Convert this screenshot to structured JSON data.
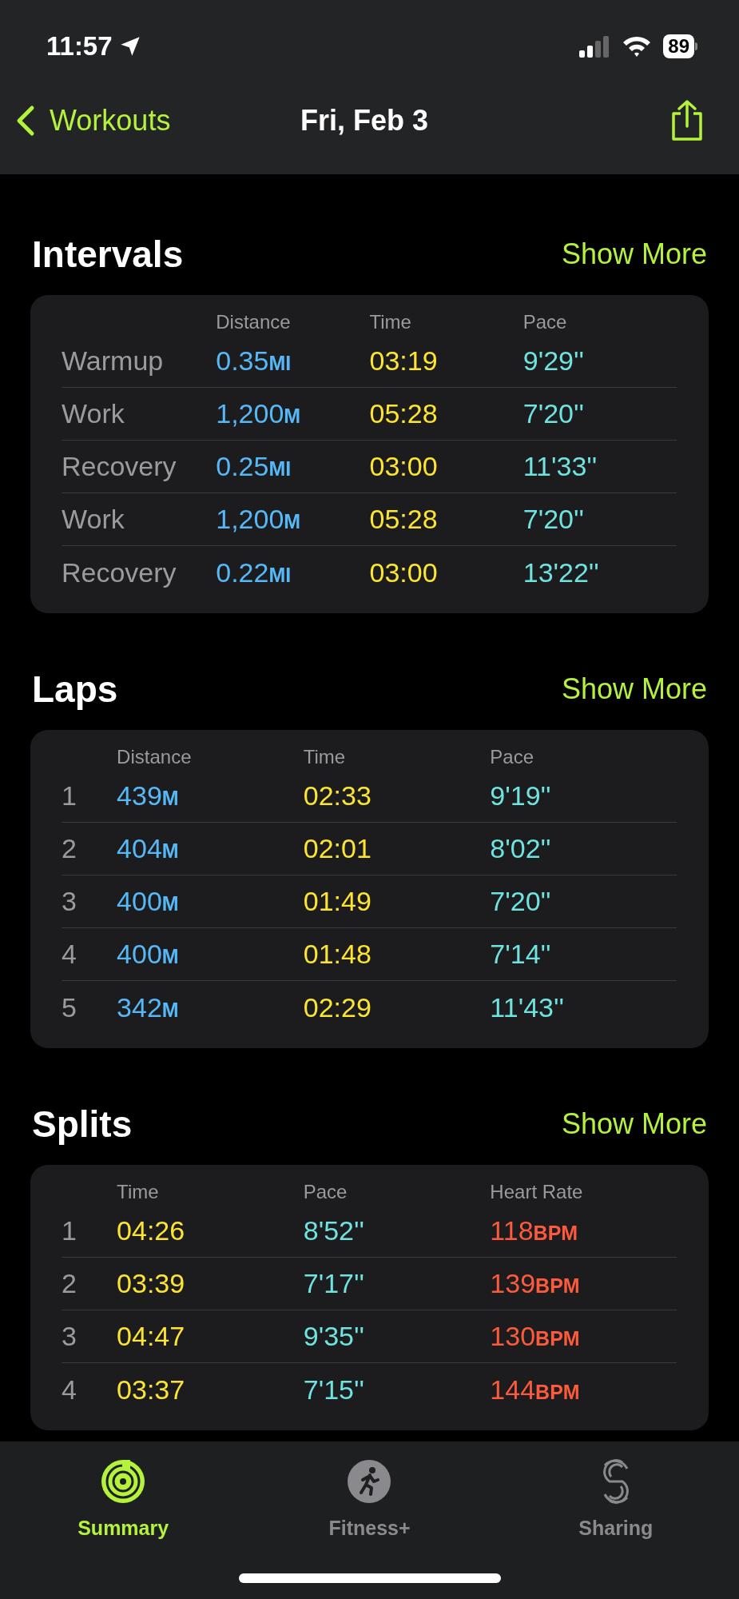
{
  "status_bar": {
    "time": "11:57",
    "battery": "89"
  },
  "nav": {
    "back": "Workouts",
    "title": "Fri, Feb 3"
  },
  "sections": [
    {
      "title": "Intervals",
      "action": "Show More",
      "columns": [
        {
          "kind": "label"
        },
        {
          "kind": "distance",
          "label": "Distance"
        },
        {
          "kind": "time",
          "label": "Time"
        },
        {
          "kind": "pace",
          "label": "Pace"
        }
      ],
      "rows": [
        [
          {
            "value": "Warmup"
          },
          {
            "value": "0.35",
            "unit": "MI"
          },
          {
            "value": "03:19"
          },
          {
            "value": "9'29''"
          }
        ],
        [
          {
            "value": "Work"
          },
          {
            "value": "1,200",
            "unit": "M"
          },
          {
            "value": "05:28"
          },
          {
            "value": "7'20''"
          }
        ],
        [
          {
            "value": "Recovery"
          },
          {
            "value": "0.25",
            "unit": "MI"
          },
          {
            "value": "03:00"
          },
          {
            "value": "11'33''"
          }
        ],
        [
          {
            "value": "Work"
          },
          {
            "value": "1,200",
            "unit": "M"
          },
          {
            "value": "05:28"
          },
          {
            "value": "7'20''"
          }
        ],
        [
          {
            "value": "Recovery"
          },
          {
            "value": "0.22",
            "unit": "MI"
          },
          {
            "value": "03:00"
          },
          {
            "value": "13'22''"
          }
        ]
      ]
    },
    {
      "title": "Laps",
      "action": "Show More",
      "columns": [
        {
          "kind": "index"
        },
        {
          "kind": "distance",
          "label": "Distance"
        },
        {
          "kind": "time",
          "label": "Time"
        },
        {
          "kind": "pace",
          "label": "Pace"
        }
      ],
      "rows": [
        [
          {
            "value": "1"
          },
          {
            "value": "439",
            "unit": "M"
          },
          {
            "value": "02:33"
          },
          {
            "value": "9'19''"
          }
        ],
        [
          {
            "value": "2"
          },
          {
            "value": "404",
            "unit": "M"
          },
          {
            "value": "02:01"
          },
          {
            "value": "8'02''"
          }
        ],
        [
          {
            "value": "3"
          },
          {
            "value": "400",
            "unit": "M"
          },
          {
            "value": "01:49"
          },
          {
            "value": "7'20''"
          }
        ],
        [
          {
            "value": "4"
          },
          {
            "value": "400",
            "unit": "M"
          },
          {
            "value": "01:48"
          },
          {
            "value": "7'14''"
          }
        ],
        [
          {
            "value": "5"
          },
          {
            "value": "342",
            "unit": "M"
          },
          {
            "value": "02:29"
          },
          {
            "value": "11'43''"
          }
        ]
      ]
    },
    {
      "title": "Splits",
      "action": "Show More",
      "columns": [
        {
          "kind": "index"
        },
        {
          "kind": "time",
          "label": "Time"
        },
        {
          "kind": "pace",
          "label": "Pace"
        },
        {
          "kind": "heart_rate",
          "label": "Heart Rate"
        }
      ],
      "rows": [
        [
          {
            "value": "1"
          },
          {
            "value": "04:26"
          },
          {
            "value": "8'52''"
          },
          {
            "value": "118",
            "unit": "BPM"
          }
        ],
        [
          {
            "value": "2"
          },
          {
            "value": "03:39"
          },
          {
            "value": "7'17''"
          },
          {
            "value": "139",
            "unit": "BPM"
          }
        ],
        [
          {
            "value": "3"
          },
          {
            "value": "04:47"
          },
          {
            "value": "9'35''"
          },
          {
            "value": "130",
            "unit": "BPM"
          }
        ],
        [
          {
            "value": "4"
          },
          {
            "value": "03:37"
          },
          {
            "value": "7'15''"
          },
          {
            "value": "144",
            "unit": "BPM"
          }
        ]
      ]
    }
  ],
  "tabs": [
    {
      "label": "Summary",
      "kind": "rings",
      "selected": true
    },
    {
      "label": "Fitness+",
      "kind": "runner",
      "selected": false
    },
    {
      "label": "Sharing",
      "kind": "sharing",
      "selected": false
    }
  ]
}
